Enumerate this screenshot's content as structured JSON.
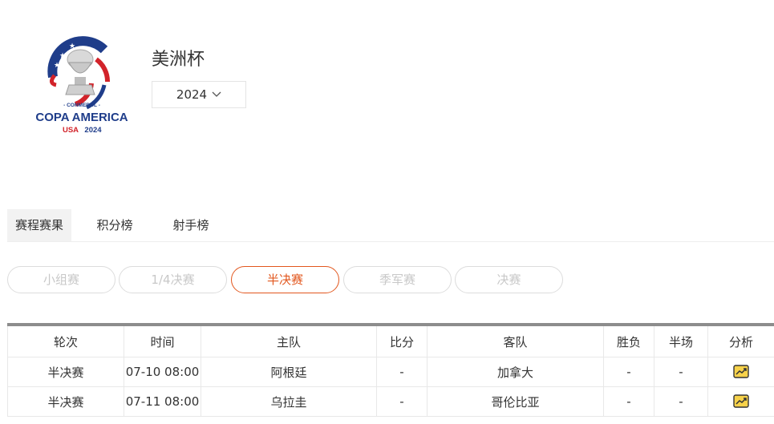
{
  "logo": {
    "org": "- CONMEBOL -",
    "name": "COPA AMERICA",
    "edition_country": "USA",
    "edition_year": "2024",
    "colors": {
      "blue": "#1f3d8a",
      "red": "#d2232a",
      "silver": "#c9c9c9"
    }
  },
  "header": {
    "title": "美洲杯",
    "year": "2024",
    "year_icon": "chevron-down-icon"
  },
  "tabs": [
    {
      "label": "赛程赛果",
      "active": true
    },
    {
      "label": "积分榜",
      "active": false
    },
    {
      "label": "射手榜",
      "active": false
    }
  ],
  "stages": [
    {
      "label": "小组赛",
      "active": false
    },
    {
      "label": "1/4决赛",
      "active": false
    },
    {
      "label": "半决赛",
      "active": true
    },
    {
      "label": "季军赛",
      "active": false
    },
    {
      "label": "决赛",
      "active": false
    }
  ],
  "accent_color": "#e2571e",
  "table": {
    "columns": [
      "轮次",
      "时间",
      "主队",
      "比分",
      "客队",
      "胜负",
      "半场",
      "分析"
    ],
    "rows": [
      {
        "round": "半决赛",
        "time": "07-10 08:00",
        "home": "阿根廷",
        "score": "-",
        "away": "加拿大",
        "result": "-",
        "half": "-",
        "analysis_icon": "chart-icon"
      },
      {
        "round": "半决赛",
        "time": "07-11 08:00",
        "home": "乌拉圭",
        "score": "-",
        "away": "哥伦比亚",
        "result": "-",
        "half": "-",
        "analysis_icon": "chart-icon"
      }
    ]
  }
}
